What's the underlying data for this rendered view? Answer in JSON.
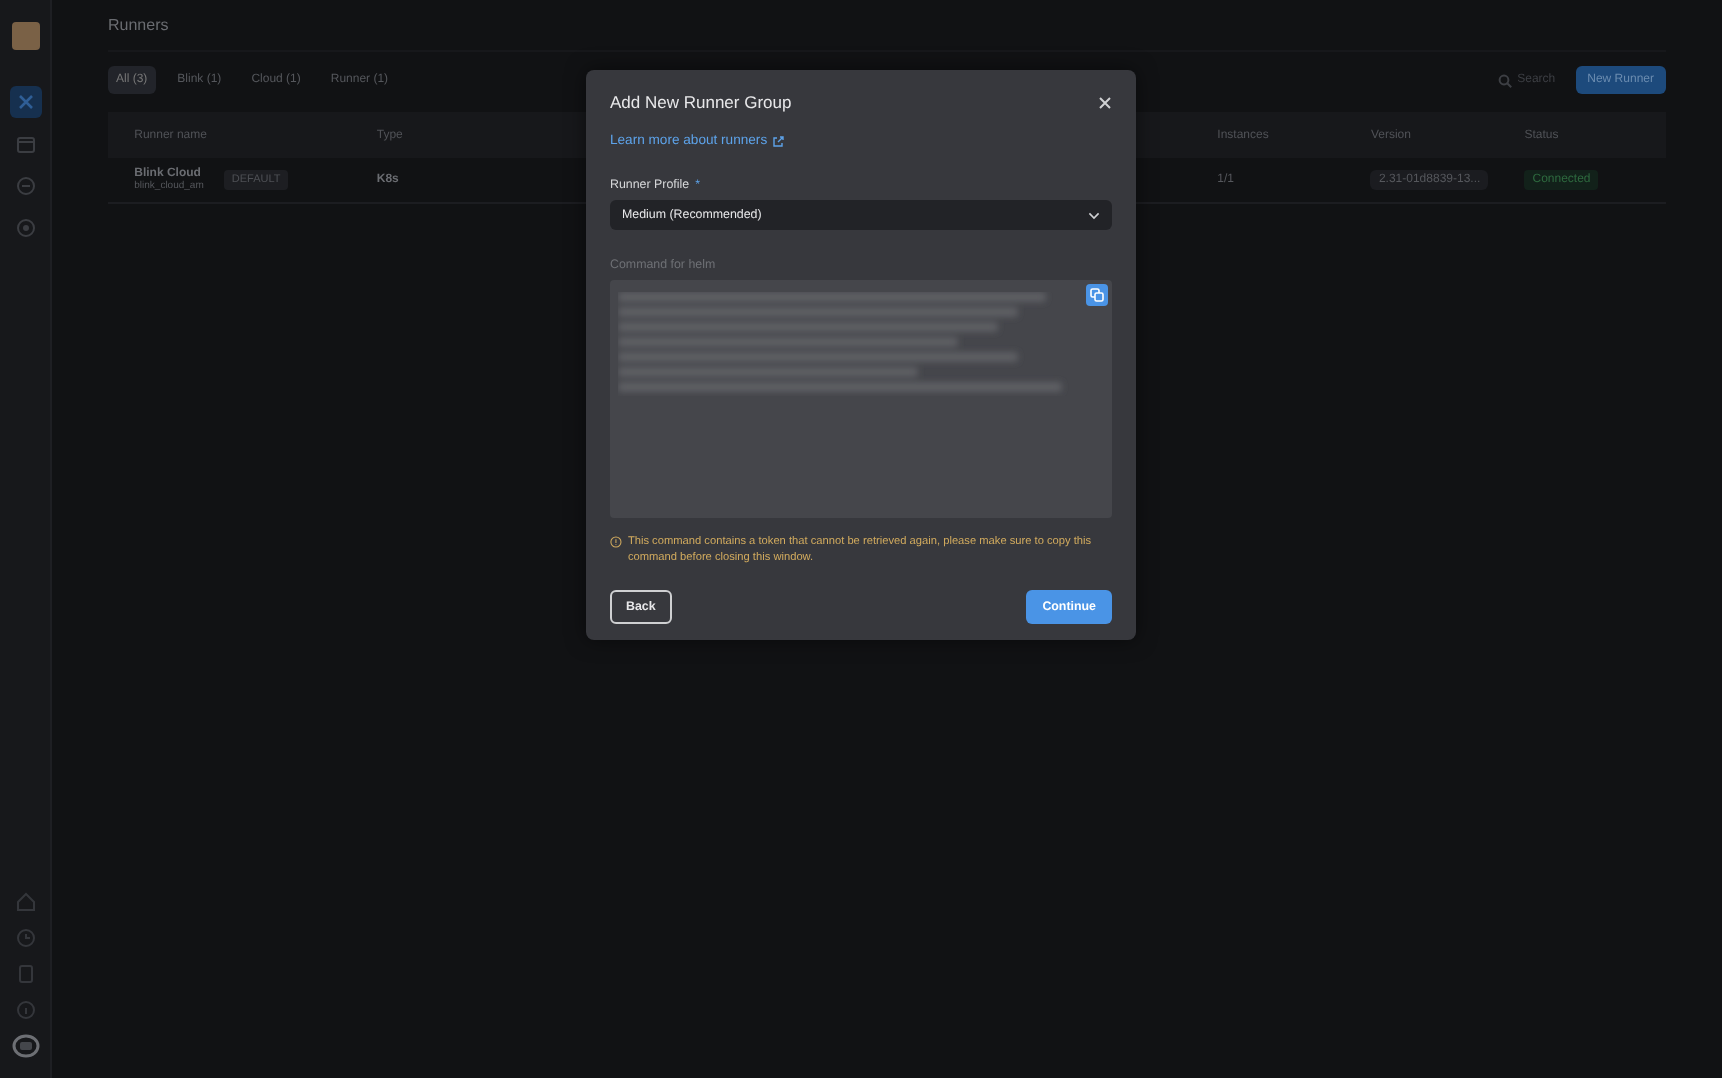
{
  "sidebar": {
    "nav_items": [
      {
        "selected": true
      },
      {
        "selected": false
      },
      {
        "selected": false
      },
      {
        "selected": false
      }
    ]
  },
  "page": {
    "title": "Runners",
    "tabs": [
      {
        "label": "All (3)",
        "selected": true
      },
      {
        "label": "Blink (1)",
        "selected": false
      },
      {
        "label": "Cloud (1)",
        "selected": false
      },
      {
        "label": "Runner (1)",
        "selected": false
      }
    ],
    "search": {
      "placeholder": "Search"
    },
    "new_button": "New Runner",
    "table": {
      "columns": [
        "Runner name",
        "Type",
        "Instances",
        "Version",
        "Status"
      ],
      "rows": [
        {
          "name": "Blink Cloud",
          "subtitle": "blink_cloud_am",
          "badge": "DEFAULT",
          "type": "K8s",
          "instances": "1/1",
          "version": "2.31-01d8839-13...",
          "status": "Connected"
        }
      ]
    }
  },
  "modal": {
    "title": "Add New Runner Group",
    "link": "Learn more about runners",
    "profile_label": "Runner Profile",
    "required_mark": "*",
    "profile_value": "Medium (Recommended)",
    "command_label": "Command for helm",
    "warning": "This command contains a token that cannot be retrieved again, please make sure to copy this command before closing this window.",
    "back": "Back",
    "continue": "Continue"
  }
}
